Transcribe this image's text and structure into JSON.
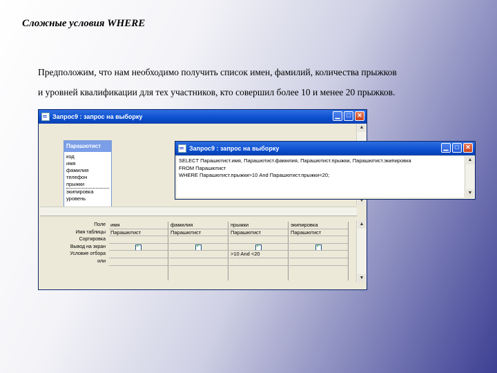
{
  "slide": {
    "title": "Сложные условия WHERE",
    "line1": "Предположим, что нам необходимо получить список имен, фамилий, количества прыжков",
    "line2": "и уровней квалификации для тех участников, кто совершил более 10 и менее 20 прыжков."
  },
  "design_window": {
    "title": "Запрос9 : запрос на выборку",
    "table_name": "Парашютист",
    "fields": [
      "код",
      "имя",
      "фамилия",
      "телефон",
      "прыжки",
      "экипировка",
      "уровень"
    ],
    "row_labels": [
      "Поле",
      "Имя таблицы",
      "Сортировка",
      "Вывод на экран",
      "Условие отбора",
      "или"
    ],
    "columns": [
      {
        "field": "имя",
        "table": "Парашютист",
        "sort": "",
        "show": true,
        "criteria": ""
      },
      {
        "field": "фамилия",
        "table": "Парашютист",
        "sort": "",
        "show": true,
        "criteria": ""
      },
      {
        "field": "прыжки",
        "table": "Парашютист",
        "sort": "",
        "show": true,
        "criteria": ">10 And <20"
      },
      {
        "field": "экипировка",
        "table": "Парашютист",
        "sort": "",
        "show": true,
        "criteria": ""
      }
    ]
  },
  "sql_window": {
    "title": "Запрос9 : запрос на выборку",
    "line1": "SELECT Парашютист.имя, Парашютист.фамилия, Парашютист.прыжки, Парашютист.экипировка",
    "line2": "FROM Парашютист",
    "line3": "WHERE Парашютист.прыжки>10 And Парашютист.прыжки<20;"
  },
  "icons": {
    "minimize": "minimize-icon",
    "maximize": "maximize-icon",
    "close": "close-icon",
    "window": "query-window-icon",
    "scroll_up": "scroll-up-icon",
    "scroll_down": "scroll-down-icon",
    "checkbox": "checkbox-checked-icon"
  },
  "colors": {
    "title_bar": "#0a4fd0",
    "window_bg": "#ece9d8",
    "table_header": "#7b9ee8",
    "close_button": "#c8411d"
  }
}
